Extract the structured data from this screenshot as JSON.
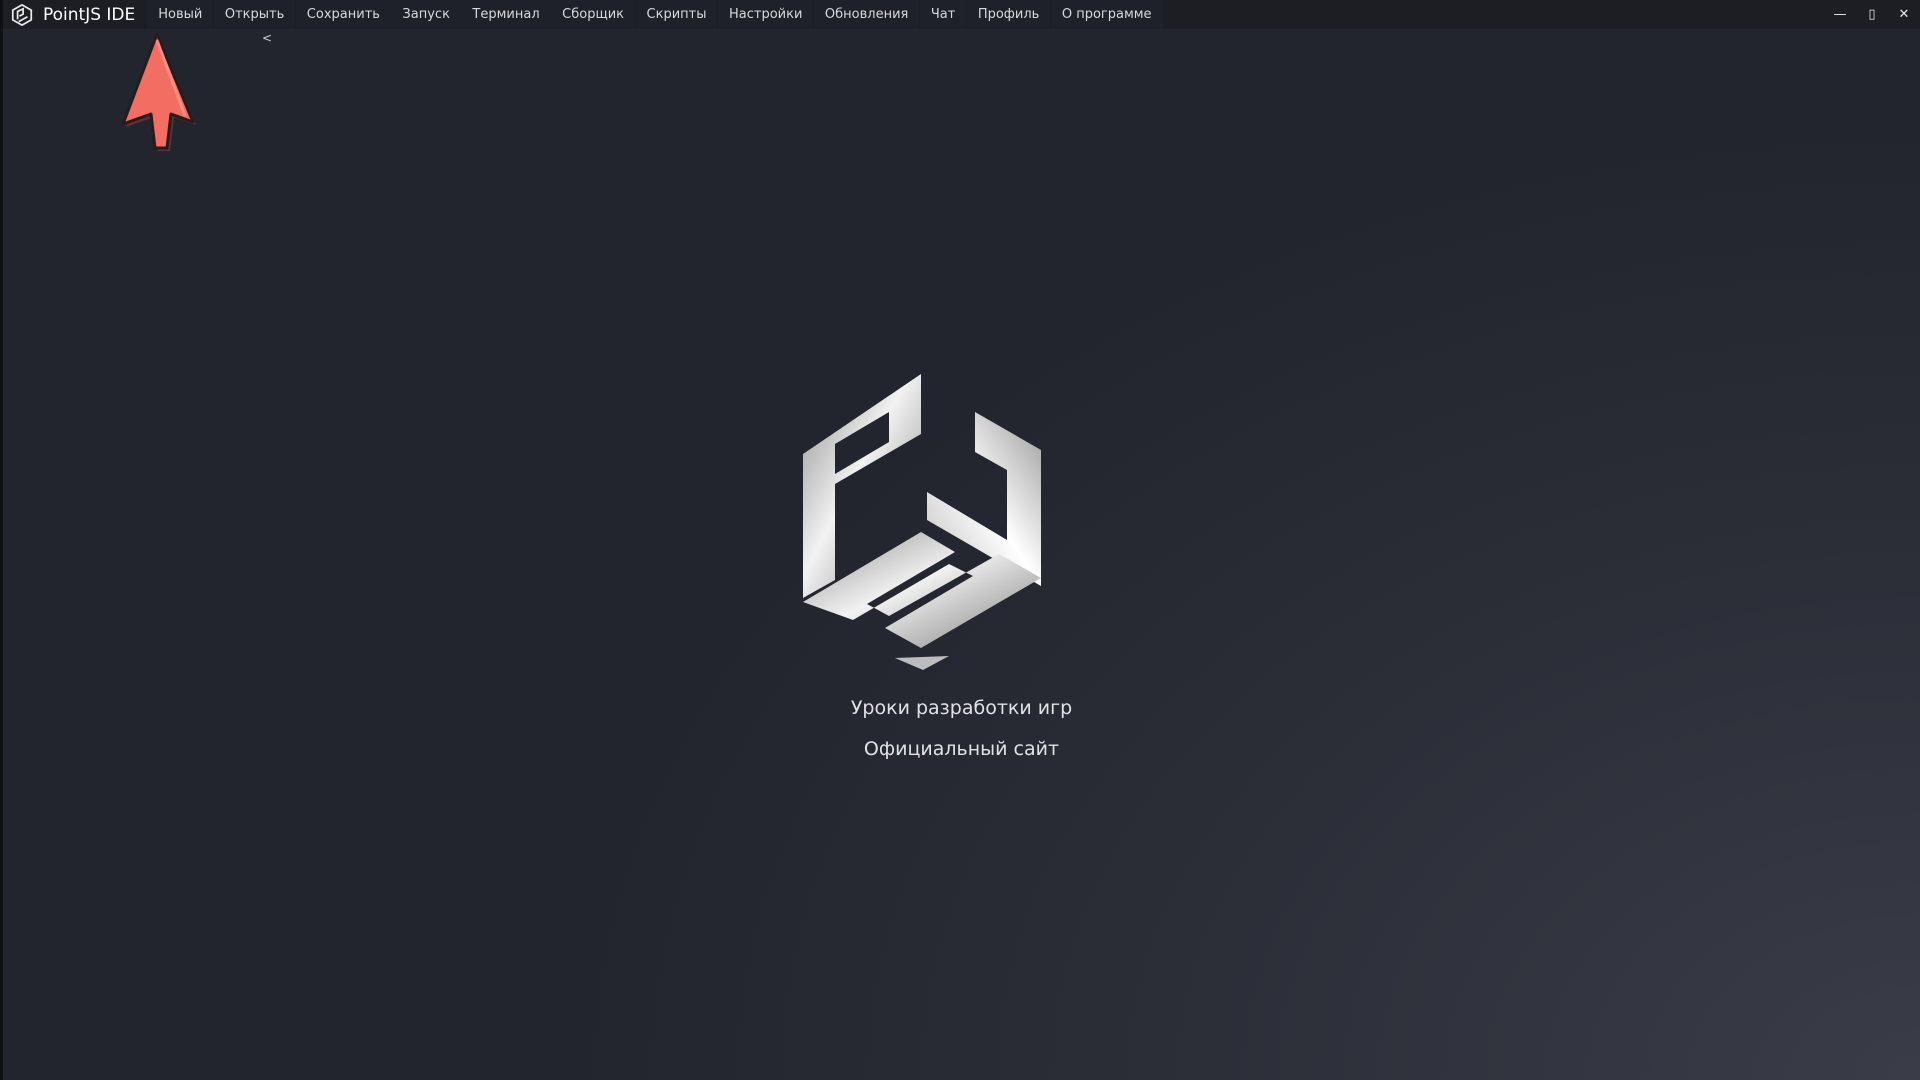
{
  "app": {
    "title": "PointJS IDE"
  },
  "menu": {
    "items": [
      {
        "label": "Новый"
      },
      {
        "label": "Открыть"
      },
      {
        "label": "Сохранить"
      },
      {
        "label": "Запуск"
      },
      {
        "label": "Терминал"
      },
      {
        "label": "Сборщик"
      },
      {
        "label": "Скрипты"
      },
      {
        "label": "Настройки"
      },
      {
        "label": "Обновления"
      },
      {
        "label": "Чат"
      },
      {
        "label": "Профиль"
      },
      {
        "label": "О программе"
      }
    ]
  },
  "window_controls": {
    "minimize": "—",
    "maximize": "▯",
    "close": "✕"
  },
  "sidebar_toggle": {
    "label": "<"
  },
  "links": {
    "lessons": "Уроки разработки игр",
    "site": "Официальный сайт"
  },
  "icons": {
    "app_logo": "pointjs-logo-icon",
    "pointer": "arrow-pointer-icon"
  },
  "colors": {
    "menubar": "#1c1e24",
    "background": "#23252e",
    "arrow": "#f26d62"
  }
}
